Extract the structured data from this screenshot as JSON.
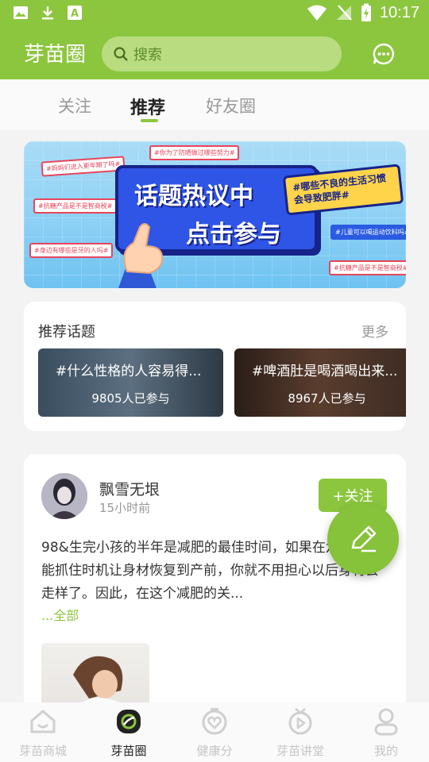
{
  "status_bar": {
    "time": "10:17"
  },
  "header": {
    "title": "芽苗圈",
    "search_placeholder": "搜索"
  },
  "tabs": [
    {
      "label": "关注",
      "active": false
    },
    {
      "label": "推荐",
      "active": true
    },
    {
      "label": "好友圈",
      "active": false
    }
  ],
  "banner": {
    "title_line1": "话题热议中",
    "title_line2": "点击参与",
    "tags": [
      "#你为了防晒做过哪些努力#",
      "#妈妈们进入更年期了吗#",
      "#哪些不良的生活习惯会导致肥胖#",
      "#抗糖产品是不是智商税#",
      "#儿童可以喝运动饮料吗#",
      "#身边有哪些是牙的人吗#",
      "#抗糖产品是不是智商税#"
    ]
  },
  "topics": {
    "heading": "推荐话题",
    "more_label": "更多",
    "items": [
      {
        "title": "#什么性格的人容易得...",
        "count": "9805人已参与"
      },
      {
        "title": "#啤酒肚是喝酒喝出来...",
        "count": "8967人已参与"
      }
    ]
  },
  "post": {
    "user_name": "飘雪无垠",
    "time": "15小时前",
    "follow_label": "+关注",
    "text": "98&生完小孩的半年是减肥的最佳时间，如果在六个月内能抓住时机让身材恢复到产前，你就不用担心以后身材会走样了。因此，在这个减肥的关...",
    "read_more": "...全部"
  },
  "bottom_nav": [
    {
      "label": "芽苗商城",
      "icon": "home-icon",
      "active": false
    },
    {
      "label": "芽苗圈",
      "icon": "circle-icon",
      "active": true
    },
    {
      "label": "健康分",
      "icon": "health-icon",
      "active": false
    },
    {
      "label": "芽苗讲堂",
      "icon": "tv-icon",
      "active": false
    },
    {
      "label": "我的",
      "icon": "user-icon",
      "active": false
    }
  ],
  "colors": {
    "brand": "#8cc63f",
    "accent_pink": "#e8455c",
    "banner_blue": "#2f55e6"
  }
}
